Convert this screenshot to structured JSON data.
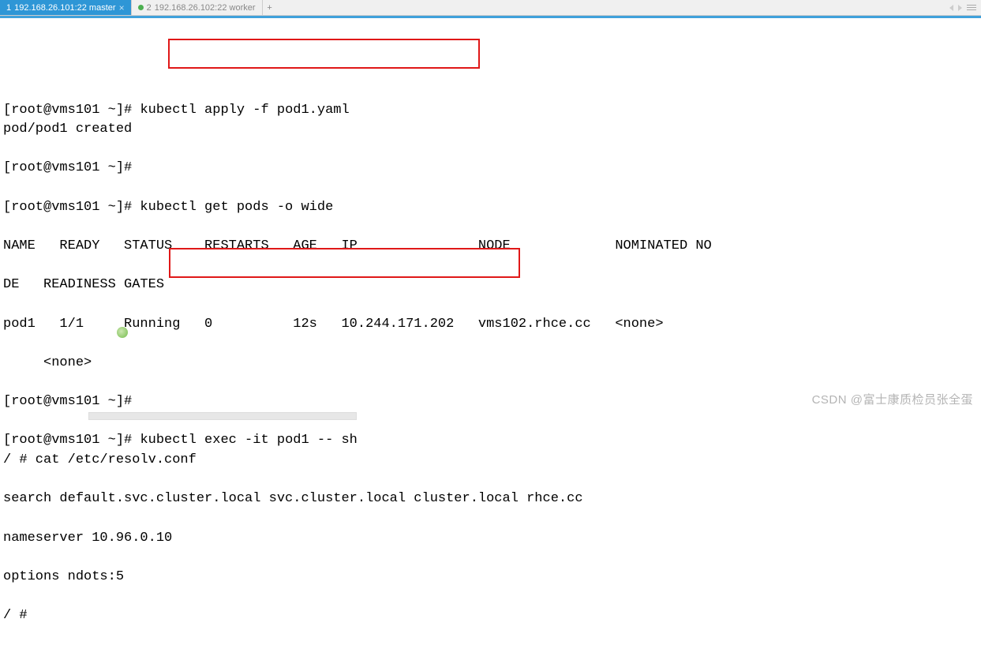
{
  "tabs": {
    "active": {
      "index": "1",
      "label": "192.168.26.101:22 master"
    },
    "inactive": {
      "index": "2",
      "label": "192.168.26.102:22 worker"
    }
  },
  "term": {
    "l01a": "[root@vms101 ~]# ",
    "l01b": "kubectl apply -f pod1.yaml",
    "l02": "pod/pod1 created",
    "l03": "[root@vms101 ~]#",
    "l04": "[root@vms101 ~]# kubectl get pods -o wide",
    "l05": "NAME   READY   STATUS    RESTARTS   AGE   IP               NODE             NOMINATED NO",
    "l06": "DE   READINESS GATES",
    "l07": "pod1   1/1     Running   0          12s   10.244.171.202   vms102.rhce.cc   <none>      ",
    "l08": "     <none>",
    "l09": "[root@vms101 ~]#",
    "l10a": "[root@vms101 ~]# ",
    "l10b": "kubectl exec -it pod1 -- sh",
    "l11": "/ # cat /etc/resolv.conf",
    "l12": "search default.svc.cluster.local svc.cluster.local cluster.local rhce.cc",
    "l13": "nameserver 10.96.0.10",
    "l14": "options ndots:5",
    "l15": "/ # "
  },
  "watermark": "CSDN @富士康质检员张全蛋"
}
